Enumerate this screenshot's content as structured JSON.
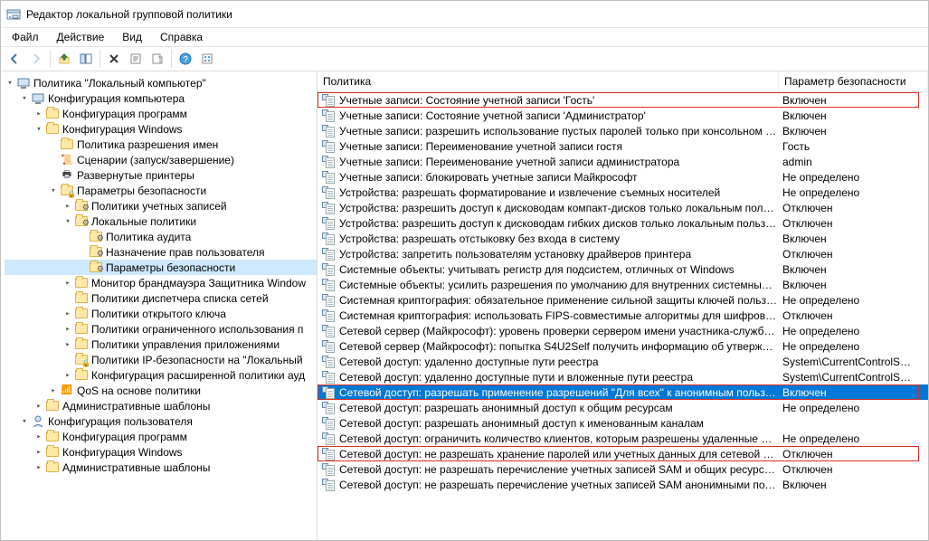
{
  "window": {
    "title": "Редактор локальной групповой политики"
  },
  "menu": {
    "file": "Файл",
    "action": "Действие",
    "view": "Вид",
    "help": "Справка"
  },
  "columns": {
    "policy": "Политика",
    "setting": "Параметр безопасности"
  },
  "tree": [
    {
      "lvl": 1,
      "label": "Политика \"Локальный компьютер\"",
      "exp": "▾",
      "icon": "comp"
    },
    {
      "lvl": 2,
      "label": "Конфигурация компьютера",
      "exp": "▾",
      "icon": "comp"
    },
    {
      "lvl": 3,
      "label": "Конфигурация программ",
      "exp": "▸",
      "icon": "folder"
    },
    {
      "lvl": 3,
      "label": "Конфигурация Windows",
      "exp": "▾",
      "icon": "folder"
    },
    {
      "lvl": 4,
      "label": "Политика разрешения имен",
      "exp": "",
      "icon": "folder"
    },
    {
      "lvl": 4,
      "label": "Сценарии (запуск/завершение)",
      "exp": "",
      "icon": "scroll"
    },
    {
      "lvl": 4,
      "label": "Развернутые принтеры",
      "exp": "",
      "icon": "printer"
    },
    {
      "lvl": 4,
      "label": "Параметры безопасности",
      "exp": "▾",
      "icon": "folder-lock"
    },
    {
      "lvl": 5,
      "label": "Политики учетных записей",
      "exp": "▸",
      "icon": "folder-gear"
    },
    {
      "lvl": 5,
      "label": "Локальные политики",
      "exp": "▾",
      "icon": "folder-gear"
    },
    {
      "lvl": 6,
      "label": "Политика аудита",
      "exp": "",
      "icon": "folder-gear"
    },
    {
      "lvl": 6,
      "label": "Назначение прав пользователя",
      "exp": "",
      "icon": "folder-gear"
    },
    {
      "lvl": 6,
      "label": "Параметры безопасности",
      "exp": "",
      "icon": "folder-gear",
      "sel": true
    },
    {
      "lvl": 5,
      "label": "Монитор брандмауэра Защитника Window",
      "exp": "▸",
      "icon": "folder"
    },
    {
      "lvl": 5,
      "label": "Политики диспетчера списка сетей",
      "exp": "",
      "icon": "folder"
    },
    {
      "lvl": 5,
      "label": "Политики открытого ключа",
      "exp": "▸",
      "icon": "folder"
    },
    {
      "lvl": 5,
      "label": "Политики ограниченного использования п",
      "exp": "▸",
      "icon": "folder"
    },
    {
      "lvl": 5,
      "label": "Политики управления приложениями",
      "exp": "▸",
      "icon": "folder"
    },
    {
      "lvl": 5,
      "label": "Политики IP-безопасности на \"Локальный",
      "exp": "",
      "icon": "folder-lock"
    },
    {
      "lvl": 5,
      "label": "Конфигурация расширенной политики ауд",
      "exp": "▸",
      "icon": "folder"
    },
    {
      "lvl": 4,
      "label": "QoS на основе политики",
      "exp": "▸",
      "icon": "qos"
    },
    {
      "lvl": 3,
      "label": "Административные шаблоны",
      "exp": "▸",
      "icon": "folder"
    },
    {
      "lvl": 2,
      "label": "Конфигурация пользователя",
      "exp": "▾",
      "icon": "user"
    },
    {
      "lvl": 3,
      "label": "Конфигурация программ",
      "exp": "▸",
      "icon": "folder"
    },
    {
      "lvl": 3,
      "label": "Конфигурация Windows",
      "exp": "▸",
      "icon": "folder"
    },
    {
      "lvl": 3,
      "label": "Административные шаблоны",
      "exp": "▸",
      "icon": "folder"
    }
  ],
  "policies": [
    {
      "name": "Учетные записи: Состояние учетной записи 'Гость'",
      "val": "Включен",
      "mark": true
    },
    {
      "name": "Учетные записи: Состояние учетной записи 'Администратор'",
      "val": "Включен"
    },
    {
      "name": "Учетные записи: разрешить использование пустых паролей только при консольном в…",
      "val": "Включен"
    },
    {
      "name": "Учетные записи: Переименование учетной записи гостя",
      "val": "Гость"
    },
    {
      "name": "Учетные записи: Переименование учетной записи администратора",
      "val": "admin"
    },
    {
      "name": "Учетные записи: блокировать учетные записи Майкрософт",
      "val": "Не определено"
    },
    {
      "name": "Устройства: разрешать форматирование и извлечение съемных носителей",
      "val": "Не определено"
    },
    {
      "name": "Устройства: разрешить доступ к дисководам компакт-дисков только локальным поль…",
      "val": "Отключен"
    },
    {
      "name": "Устройства: разрешить доступ к дисководам гибких дисков только локальным пользо…",
      "val": "Отключен"
    },
    {
      "name": "Устройства: разрешать отстыковку без входа в систему",
      "val": "Включен"
    },
    {
      "name": "Устройства: запретить пользователям установку драйверов принтера",
      "val": "Отключен"
    },
    {
      "name": "Системные объекты: учитывать регистр для подсистем, отличных от Windows",
      "val": "Включен"
    },
    {
      "name": "Системные объекты: усилить разрешения по умолчанию для внутренних системных …",
      "val": "Включен"
    },
    {
      "name": "Системная криптография: обязательное применение сильной защиты ключей польз…",
      "val": "Не определено"
    },
    {
      "name": "Системная криптография: использовать FIPS-совместимые алгоритмы для шифрова…",
      "val": "Отключен"
    },
    {
      "name": "Сетевой сервер (Майкрософт): уровень проверки сервером имени участника-служб…",
      "val": "Не определено"
    },
    {
      "name": "Сетевой сервер (Майкрософт): попытка S4U2Self получить информацию об утвержде…",
      "val": "Не определено"
    },
    {
      "name": "Сетевой доступ: удаленно доступные пути реестра",
      "val": "System\\CurrentControlS…"
    },
    {
      "name": "Сетевой доступ: удаленно доступные пути и вложенные пути реестра",
      "val": "System\\CurrentControlS…"
    },
    {
      "name": "Сетевой доступ: разрешать применение разрешений \"Для всех\" к анонимным пользо…",
      "val": "Включен",
      "sel": true,
      "mark": true
    },
    {
      "name": "Сетевой доступ: разрешать анонимный доступ к общим ресурсам",
      "val": "Не определено"
    },
    {
      "name": "Сетевой доступ: разрешать анонимный доступ к именованным каналам",
      "val": ""
    },
    {
      "name": "Сетевой доступ: ограничить количество клиентов, которым разрешены удаленные в…",
      "val": "Не определено"
    },
    {
      "name": "Сетевой доступ: не разрешать хранение паролей или учетных данных для сетевой про…",
      "val": "Отключен",
      "mark": true
    },
    {
      "name": "Сетевой доступ: не разрешать перечисление учетных записей SAM и общих ресурсов …",
      "val": "Отключен"
    },
    {
      "name": "Сетевой доступ: не разрешать перечисление учетных записей SAM анонимными поль…",
      "val": "Включен"
    }
  ]
}
